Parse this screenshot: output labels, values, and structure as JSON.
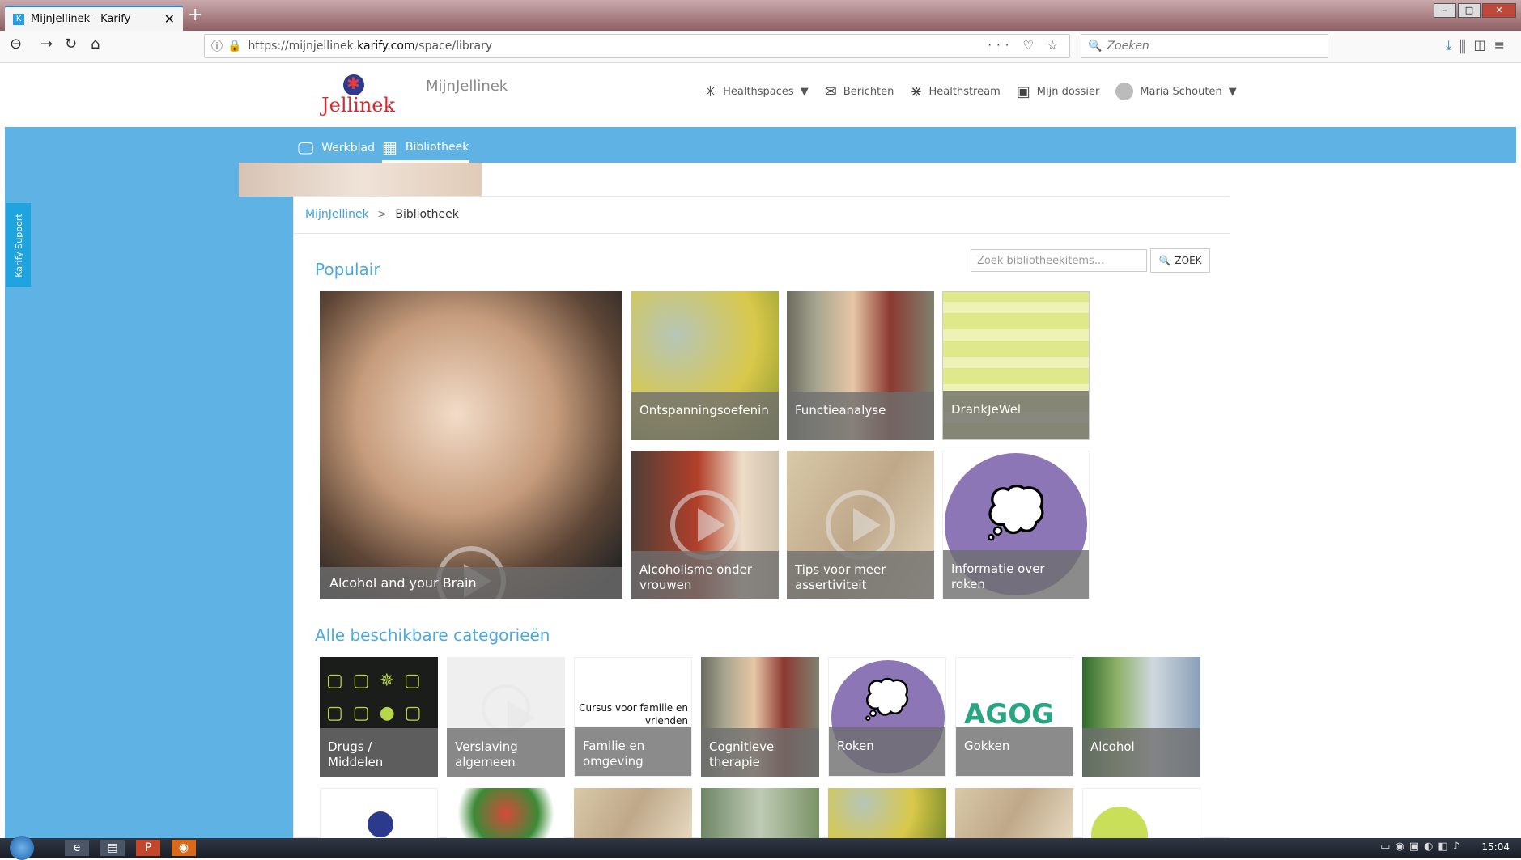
{
  "browser": {
    "tab_title": "MijnJellinek - Karify",
    "url_prefix": "https://mijnjellinek.",
    "url_domain": "karify.com",
    "url_path": "/space/library",
    "search_placeholder": "Zoeken"
  },
  "header": {
    "logo_text": "Jellinek",
    "space_name": "MijnJellinek",
    "nav": [
      "Healthspaces",
      "Berichten",
      "Healthstream",
      "Mijn dossier",
      "Maria Schouten"
    ]
  },
  "subnav": {
    "werkblad": "Werkblad",
    "bibliotheek": "Bibliotheek"
  },
  "support_tab": "Karify Support",
  "breadcrumb": {
    "home": "MijnJellinek",
    "sep": ">",
    "current": "Bibliotheek"
  },
  "library": {
    "popular_heading": "Populair",
    "search_placeholder": "Zoek bibliotheekitems...",
    "search_button": "ZOEK",
    "popular": [
      "Alcohol and your Brain",
      "Ontspanningsoefenin",
      "Functieanalyse",
      "DrankJeWel",
      "Alcoholisme onder vrouwen",
      "Tips voor meer assertiviteit",
      "Informatie over roken"
    ],
    "categories_heading": "Alle beschikbare categorieën",
    "categories": [
      "Drugs / Middelen",
      "Verslaving algemeen",
      "Familie en omgeving",
      "Cognitieve therapie",
      "Roken",
      "Gokken",
      "Alcohol"
    ],
    "familie_thumb_text": "Cursus voor familie en vrienden",
    "gokken_logo": "AGOG"
  },
  "taskbar": {
    "clock": "15:04"
  }
}
